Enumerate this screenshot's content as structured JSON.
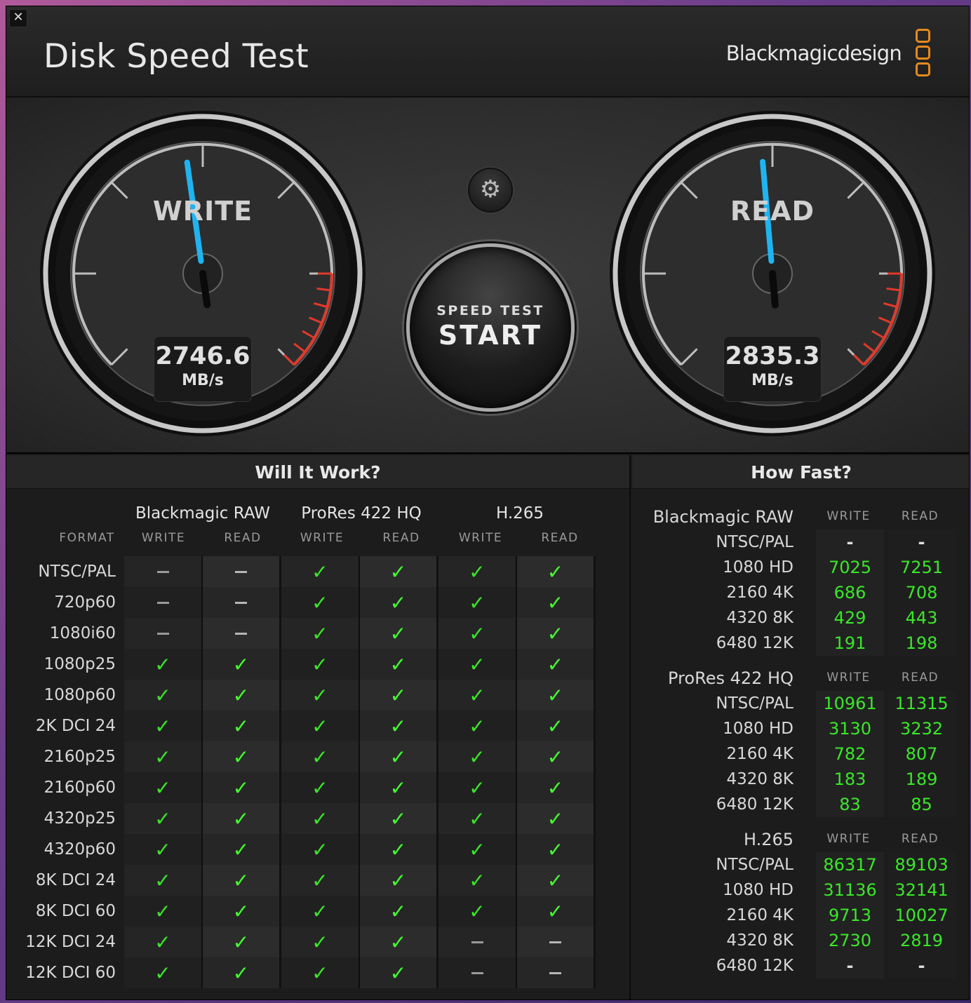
{
  "app": {
    "title": "Disk Speed Test",
    "brand": "Blackmagicdesign",
    "close": "✕"
  },
  "gauges": {
    "write": {
      "label": "WRITE",
      "value": "2746.6",
      "unit": "MB/s"
    },
    "read": {
      "label": "READ",
      "value": "2835.3",
      "unit": "MB/s"
    }
  },
  "controls": {
    "settings_icon": "gear-icon",
    "start_sub": "SPEED TEST",
    "start_main": "START"
  },
  "will_it_work": {
    "title": "Will It Work?",
    "format_header": "FORMAT",
    "codecs": [
      "Blackmagic RAW",
      "ProRes 422 HQ",
      "H.265"
    ],
    "subcols": [
      "WRITE",
      "READ",
      "WRITE",
      "READ",
      "WRITE",
      "READ"
    ],
    "rows": [
      {
        "format": "NTSC/PAL",
        "status": [
          "-",
          "-",
          "ok",
          "ok",
          "ok",
          "ok"
        ]
      },
      {
        "format": "720p60",
        "status": [
          "-",
          "-",
          "ok",
          "ok",
          "ok",
          "ok"
        ]
      },
      {
        "format": "1080i60",
        "status": [
          "-",
          "-",
          "ok",
          "ok",
          "ok",
          "ok"
        ]
      },
      {
        "format": "1080p25",
        "status": [
          "ok",
          "ok",
          "ok",
          "ok",
          "ok",
          "ok"
        ]
      },
      {
        "format": "1080p60",
        "status": [
          "ok",
          "ok",
          "ok",
          "ok",
          "ok",
          "ok"
        ]
      },
      {
        "format": "2K DCI 24",
        "status": [
          "ok",
          "ok",
          "ok",
          "ok",
          "ok",
          "ok"
        ]
      },
      {
        "format": "2160p25",
        "status": [
          "ok",
          "ok",
          "ok",
          "ok",
          "ok",
          "ok"
        ]
      },
      {
        "format": "2160p60",
        "status": [
          "ok",
          "ok",
          "ok",
          "ok",
          "ok",
          "ok"
        ]
      },
      {
        "format": "4320p25",
        "status": [
          "ok",
          "ok",
          "ok",
          "ok",
          "ok",
          "ok"
        ]
      },
      {
        "format": "4320p60",
        "status": [
          "ok",
          "ok",
          "ok",
          "ok",
          "ok",
          "ok"
        ]
      },
      {
        "format": "8K DCI 24",
        "status": [
          "ok",
          "ok",
          "ok",
          "ok",
          "ok",
          "ok"
        ]
      },
      {
        "format": "8K DCI 60",
        "status": [
          "ok",
          "ok",
          "ok",
          "ok",
          "ok",
          "ok"
        ]
      },
      {
        "format": "12K DCI 24",
        "status": [
          "ok",
          "ok",
          "ok",
          "ok",
          "-",
          "-"
        ]
      },
      {
        "format": "12K DCI 60",
        "status": [
          "ok",
          "ok",
          "ok",
          "ok",
          "-",
          "-"
        ]
      }
    ]
  },
  "how_fast": {
    "title": "How Fast?",
    "col_write": "WRITE",
    "col_read": "READ",
    "groups": [
      {
        "codec": "Blackmagic RAW",
        "rows": [
          {
            "format": "NTSC/PAL",
            "write": "-",
            "read": "-"
          },
          {
            "format": "1080 HD",
            "write": "7025",
            "read": "7251"
          },
          {
            "format": "2160 4K",
            "write": "686",
            "read": "708"
          },
          {
            "format": "4320 8K",
            "write": "429",
            "read": "443"
          },
          {
            "format": "6480 12K",
            "write": "191",
            "read": "198"
          }
        ]
      },
      {
        "codec": "ProRes 422 HQ",
        "rows": [
          {
            "format": "NTSC/PAL",
            "write": "10961",
            "read": "11315"
          },
          {
            "format": "1080 HD",
            "write": "3130",
            "read": "3232"
          },
          {
            "format": "2160 4K",
            "write": "782",
            "read": "807"
          },
          {
            "format": "4320 8K",
            "write": "183",
            "read": "189"
          },
          {
            "format": "6480 12K",
            "write": "83",
            "read": "85"
          }
        ]
      },
      {
        "codec": "H.265",
        "rows": [
          {
            "format": "NTSC/PAL",
            "write": "86317",
            "read": "89103"
          },
          {
            "format": "1080 HD",
            "write": "31136",
            "read": "32141"
          },
          {
            "format": "2160 4K",
            "write": "9713",
            "read": "10027"
          },
          {
            "format": "4320 8K",
            "write": "2730",
            "read": "2819"
          },
          {
            "format": "6480 12K",
            "write": "-",
            "read": "-"
          }
        ]
      }
    ]
  },
  "colors": {
    "check": "#39e826",
    "needle": "#1fb4f0",
    "redzone": "#e0392b",
    "brand_logo": "#e58a1f"
  }
}
